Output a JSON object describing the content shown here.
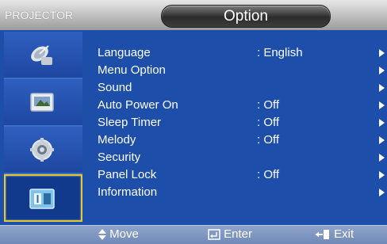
{
  "header": {
    "brand": "PROJECTOR",
    "title": "Option"
  },
  "sidebar": {
    "items": [
      {
        "icon": "satellite-dish-icon",
        "selected": false
      },
      {
        "icon": "picture-screen-icon",
        "selected": false
      },
      {
        "icon": "gear-icon",
        "selected": false
      },
      {
        "icon": "option-tool-icon",
        "selected": true
      }
    ]
  },
  "menu": {
    "items": [
      {
        "label": "Language",
        "value": ": English"
      },
      {
        "label": "Menu Option",
        "value": ""
      },
      {
        "label": "Sound",
        "value": ""
      },
      {
        "label": "Auto Power On",
        "value": ": Off"
      },
      {
        "label": "Sleep Timer",
        "value": ": Off"
      },
      {
        "label": "Melody",
        "value": ": Off"
      },
      {
        "label": "Security",
        "value": ""
      },
      {
        "label": "Panel Lock",
        "value": ": Off"
      },
      {
        "label": "Information",
        "value": ""
      }
    ]
  },
  "footer": {
    "move": "Move",
    "enter": "Enter",
    "exit": "Exit"
  },
  "colors": {
    "background": "#1c4eaa",
    "accent": "#e3c92f",
    "footer": "#7f96c0"
  }
}
